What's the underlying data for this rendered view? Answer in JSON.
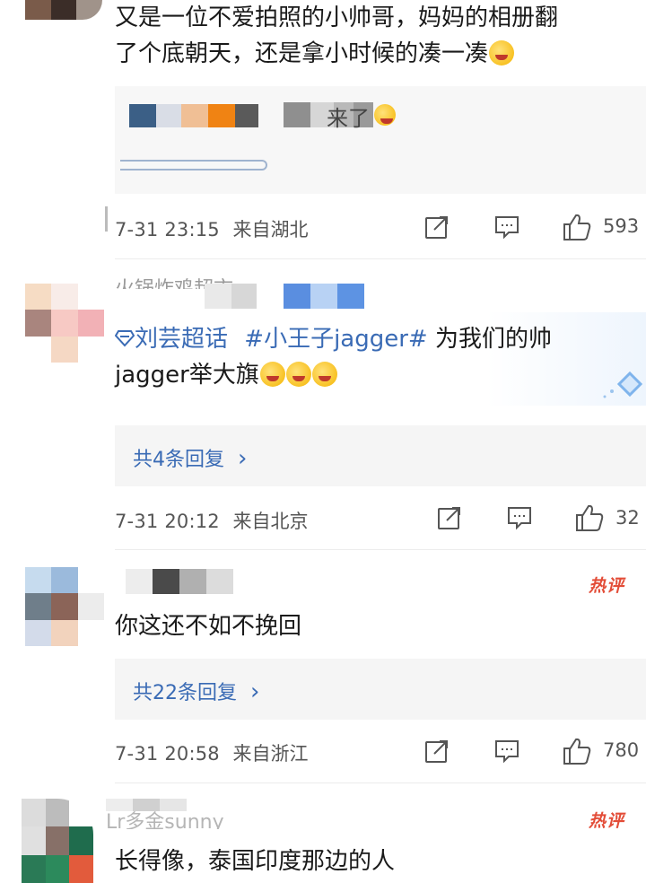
{
  "comments": [
    {
      "text_line1": "又是一位不爱拍照的小帅哥，妈妈的相册翻",
      "text_line2": "了个底朝天，还是拿小时候的凑一凑",
      "quote_partial": "来了",
      "time": "7-31 23:15",
      "location": "来自湖北",
      "likes": "593"
    },
    {
      "username": "火锅炸鸡超市",
      "topic_link": "刘芸超话",
      "hashtag": "#小王子jagger#",
      "text_after": " 为我们的帅",
      "text_line2": "jagger举大旗",
      "replies_label": "共4条回复",
      "replies_chevron": "›",
      "time": "7-31 20:12",
      "location": "来自北京",
      "likes": "32"
    },
    {
      "hot_badge": "热评",
      "text": "你这还不如不挽回",
      "replies_label": "共22条回复",
      "replies_chevron": "›",
      "time": "7-31 20:58",
      "location": "来自浙江",
      "likes": "780"
    },
    {
      "username": "Lr多金sunny",
      "hot_badge": "热评",
      "text": "长得像，泰国印度那边的人"
    }
  ],
  "icons": {
    "share": "share-icon",
    "comment": "comment-icon",
    "like": "like-icon",
    "supertopic": "supertopic-icon"
  },
  "colors": {
    "link": "#3a6bb5",
    "hot": "#e34d38",
    "meta": "#555555"
  }
}
